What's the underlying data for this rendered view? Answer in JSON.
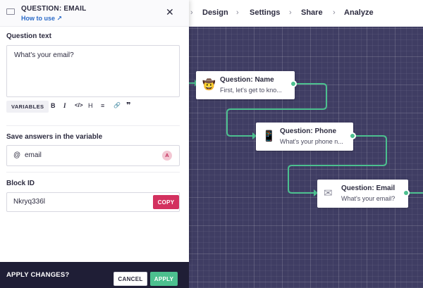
{
  "nav": {
    "items": [
      "Design",
      "Settings",
      "Share",
      "Analyze"
    ],
    "separator": "›"
  },
  "panel": {
    "header_title": "QUESTION: EMAIL",
    "header_link": "How to use",
    "question_label": "Question text",
    "question_text": "What's your email?",
    "toolbar": {
      "variables": "VARIABLES",
      "bold": "B",
      "italic": "I",
      "code": "</>",
      "heading": "H",
      "list": "≡",
      "link": "🔗",
      "quote": "❞"
    },
    "save_label": "Save answers in the variable",
    "variable_prefix": "@",
    "variable_name": "email",
    "variable_badge": "A",
    "block_id_label": "Block ID",
    "block_id": "Nkryq336l",
    "copy_label": "COPY"
  },
  "bottom": {
    "apply_changes": "APPLY CHANGES?",
    "cancel": "CANCEL",
    "apply": "APPLY"
  },
  "blocks": [
    {
      "emoji": "🤠",
      "title": "Question: Name",
      "subtitle": "First, let's get to kno..."
    },
    {
      "emoji": "📱",
      "title": "Question: Phone",
      "subtitle": "What's your phone n..."
    },
    {
      "emoji": "✉",
      "title": "Question: Email",
      "subtitle": "What's your email?"
    }
  ],
  "colors": {
    "canvas": "#3f3d63",
    "connector": "#4cc08f",
    "copy_button": "#d3315f",
    "apply_button": "#4cc08f",
    "link": "#2a6ac8"
  }
}
